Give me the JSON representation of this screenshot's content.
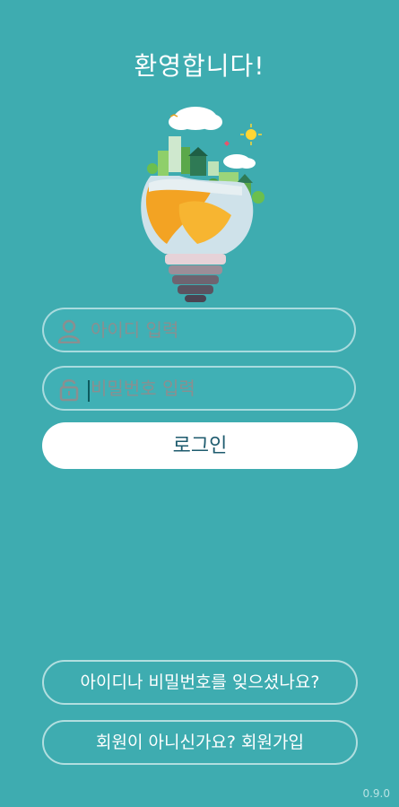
{
  "header": {
    "title": "환영합니다!"
  },
  "login_form": {
    "id_field": {
      "placeholder": "아이디 입력",
      "icon": "user-icon"
    },
    "password_field": {
      "placeholder": "비밀번호 입력",
      "icon": "lock-icon"
    },
    "login_label": "로그인"
  },
  "footer": {
    "forgot_label": "아이디나 비밀번호를 잊으셨나요?",
    "signup_label": "회원이 아니신가요? 회원가입",
    "version": "0.9.0"
  },
  "colors": {
    "background": "#3eacb0",
    "button_text": "#1e5b6e",
    "placeholder": "#8a8f90"
  }
}
